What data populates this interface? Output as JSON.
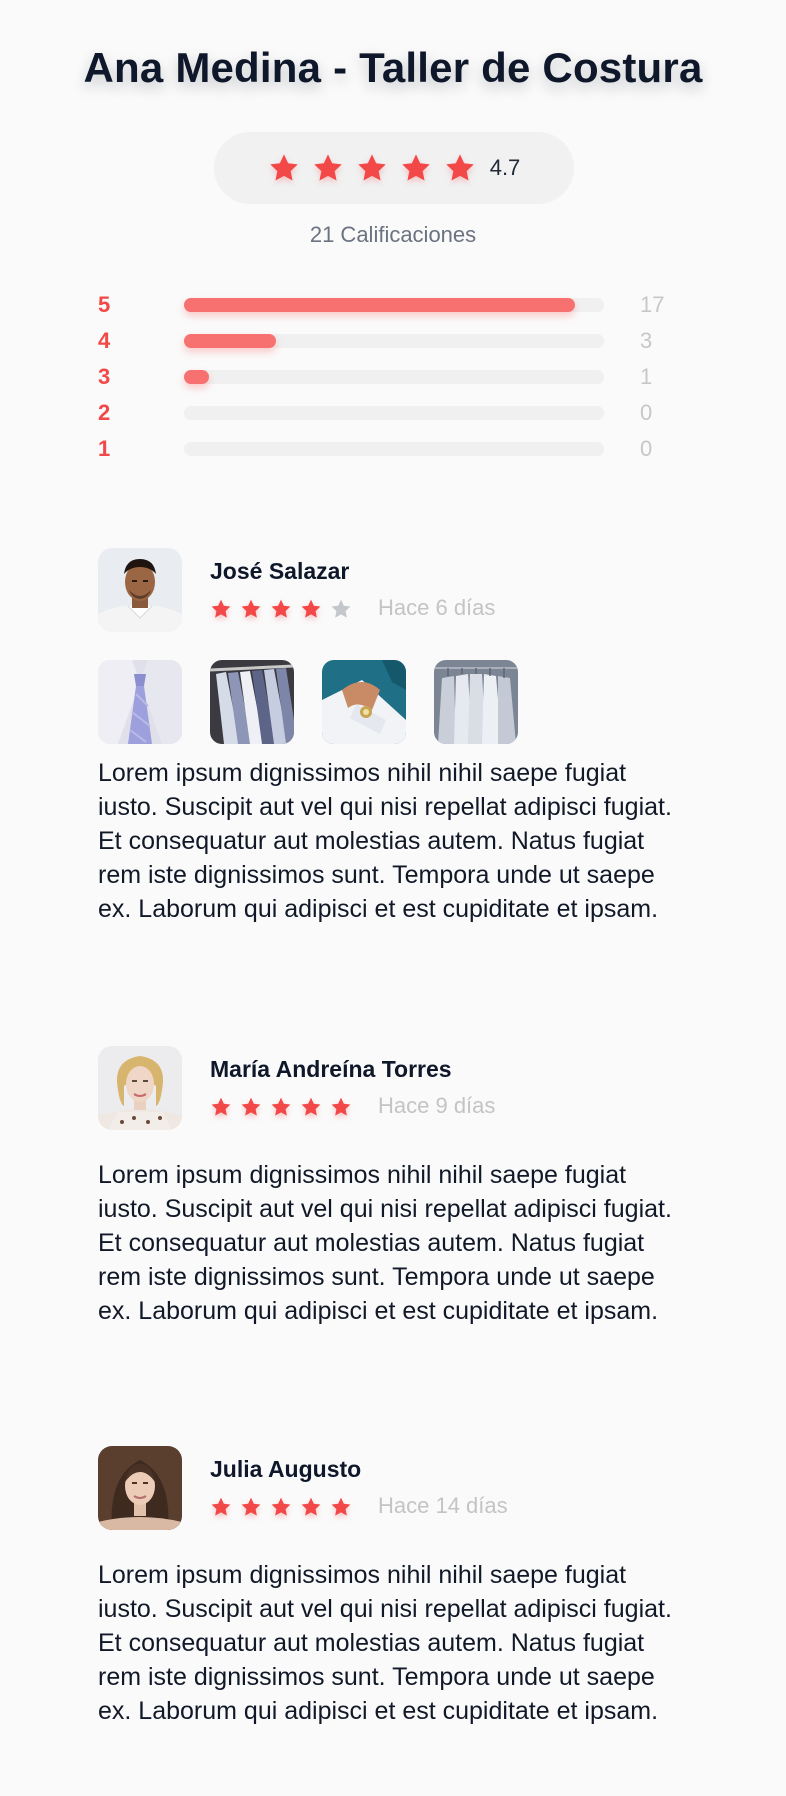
{
  "header": {
    "title": "Ana Medina - Taller de Costura"
  },
  "summary": {
    "average": "4.7",
    "stars_filled": 5,
    "count_label": "21 Calificaciones"
  },
  "distribution": [
    {
      "label": "5",
      "count": "17",
      "fraction": 0.93
    },
    {
      "label": "4",
      "count": "3",
      "fraction": 0.22
    },
    {
      "label": "3",
      "count": "1",
      "fraction": 0.06
    },
    {
      "label": "2",
      "count": "0",
      "fraction": 0
    },
    {
      "label": "1",
      "count": "0",
      "fraction": 0
    }
  ],
  "reviews": [
    {
      "name": "José Salazar",
      "rating": 4,
      "date": "Hace 6 días",
      "text": "Lorem ipsum dignissimos nihil nihil saepe fugiat iusto. Suscipit aut vel qui nisi repellat adipisci fugiat. Et consequatur aut molestias autem. Natus fugiat rem iste dignissimos sunt. Tempora unde ut saepe ex. Laborum qui adipisci et est cupiditate et ipsam.",
      "photos": [
        "shirt-tie-photo",
        "shirts-rack-photo",
        "cufflink-photo",
        "shirts-hanger-photo"
      ]
    },
    {
      "name": "María Andreína Torres",
      "rating": 5,
      "date": "Hace 9 días",
      "text": "Lorem ipsum dignissimos nihil nihil saepe fugiat iusto. Suscipit aut vel qui nisi repellat adipisci fugiat. Et consequatur aut molestias autem. Natus fugiat rem iste dignissimos sunt. Tempora unde ut saepe ex. Laborum qui adipisci et est cupiditate et ipsam.",
      "photos": []
    },
    {
      "name": "Julia Augusto",
      "rating": 5,
      "date": "Hace 14 días",
      "text": "Lorem ipsum dignissimos nihil nihil saepe fugiat iusto. Suscipit aut vel qui nisi repellat adipisci fugiat. Et consequatur aut molestias autem. Natus fugiat rem iste dignissimos sunt. Tempora unde ut saepe ex. Laborum qui adipisci et est cupiditate et ipsam.",
      "photos": []
    }
  ],
  "colors": {
    "accent": "#f34848",
    "bar": "#f87171",
    "track": "#f0f0f0",
    "empty_star": "#c4c7cc"
  }
}
